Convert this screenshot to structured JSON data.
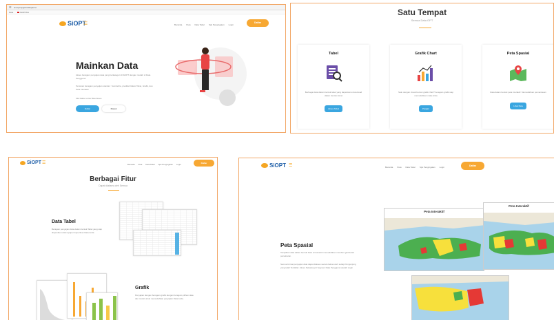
{
  "panel1": {
    "browser_url": "simopt.tlpgsb.id/depan/d",
    "browser_tabs": [
      "Peta",
      "SiOPTAN"
    ],
    "logo": "SiOPT",
    "nav": [
      "Beranda",
      "Peta",
      "Data Tabel",
      "Spk Pengingatan",
      "Login"
    ],
    "daftar_label": "Daftar",
    "hero_title": "Mainkan Data",
    "hero_p1": "Akses beragam penyajian data yang berkategori di SiOPT dengan mudah di Data Pengguna!",
    "hero_p2": "Temukan beragam penyajian standar : Sumberha, prediksi Dalam Tabel, Grafik, dan Peta Interaktif",
    "hero_p3": "Klik Daftar untuk Bisa Akses",
    "btn_daftar": "Daftar",
    "btn_masuk": "Masuk"
  },
  "panel2": {
    "title": "Satu Tempat",
    "subtitle": "Semua Data OPT",
    "cards": [
      {
        "title": "Tabel",
        "desc": "Berbagai data dalam bentuk tabel yang dapat kamu download dalam bentuk Excel",
        "button": "Akses Tabel"
      },
      {
        "title": "Grafik Chart",
        "desc": "Satu dengan visual bentuk grafik chart? beragam grafik siap memudahkan mata Anda",
        "button": "Pelajari"
      },
      {
        "title": "Peta Spasial",
        "desc": "Data dalam bentuk peta interaktif. Memudahkan pemantauan",
        "button": "Lihat Peta"
      }
    ]
  },
  "panel3": {
    "logo": "SiOPT",
    "nav": [
      "Beranda",
      "Peta",
      "Data Tabel",
      "Spk Pengingatan",
      "Login"
    ],
    "daftar_label": "Daftar",
    "title": "Berbagai Fitur",
    "subtitle": "Dapat diakses oleh Semua",
    "feat1_title": "Data Tabel",
    "feat1_desc": "Beragam penyajian data dalam bentuk Tabel yang siap disponibel untuk apapun keperluan Data Anda.",
    "feat2_title": "Grafik",
    "feat2_desc": "Penyajian dengan beragam grafik dengan beragam pilihan data dan model untuk memudahkan penyajian Data Anda."
  },
  "panel4": {
    "logo": "SiOPT",
    "nav": [
      "Beranda",
      "Peta",
      "Data Tabel",
      "Spk Pengingatan",
      "Login"
    ],
    "daftar_label": "Daftar",
    "title": "Peta Spasial",
    "p1": "Tampilkan data dalam bentuk Peta untuk lebih memudahkan memberi gambaran persebaran.",
    "p2": "Semua format penyajian data dapat diakses secara bebas oleh setiap Pengunjung yang telah Terdaftar. Akses Sekarang di Segmen Data Pengguna setelah Login",
    "map1_title": "Peta Interaktif",
    "map2_title": "Peta Interaktif"
  },
  "colors": {
    "accent": "#f7a833",
    "blue": "#3aa6e0",
    "border": "#f2a766"
  }
}
